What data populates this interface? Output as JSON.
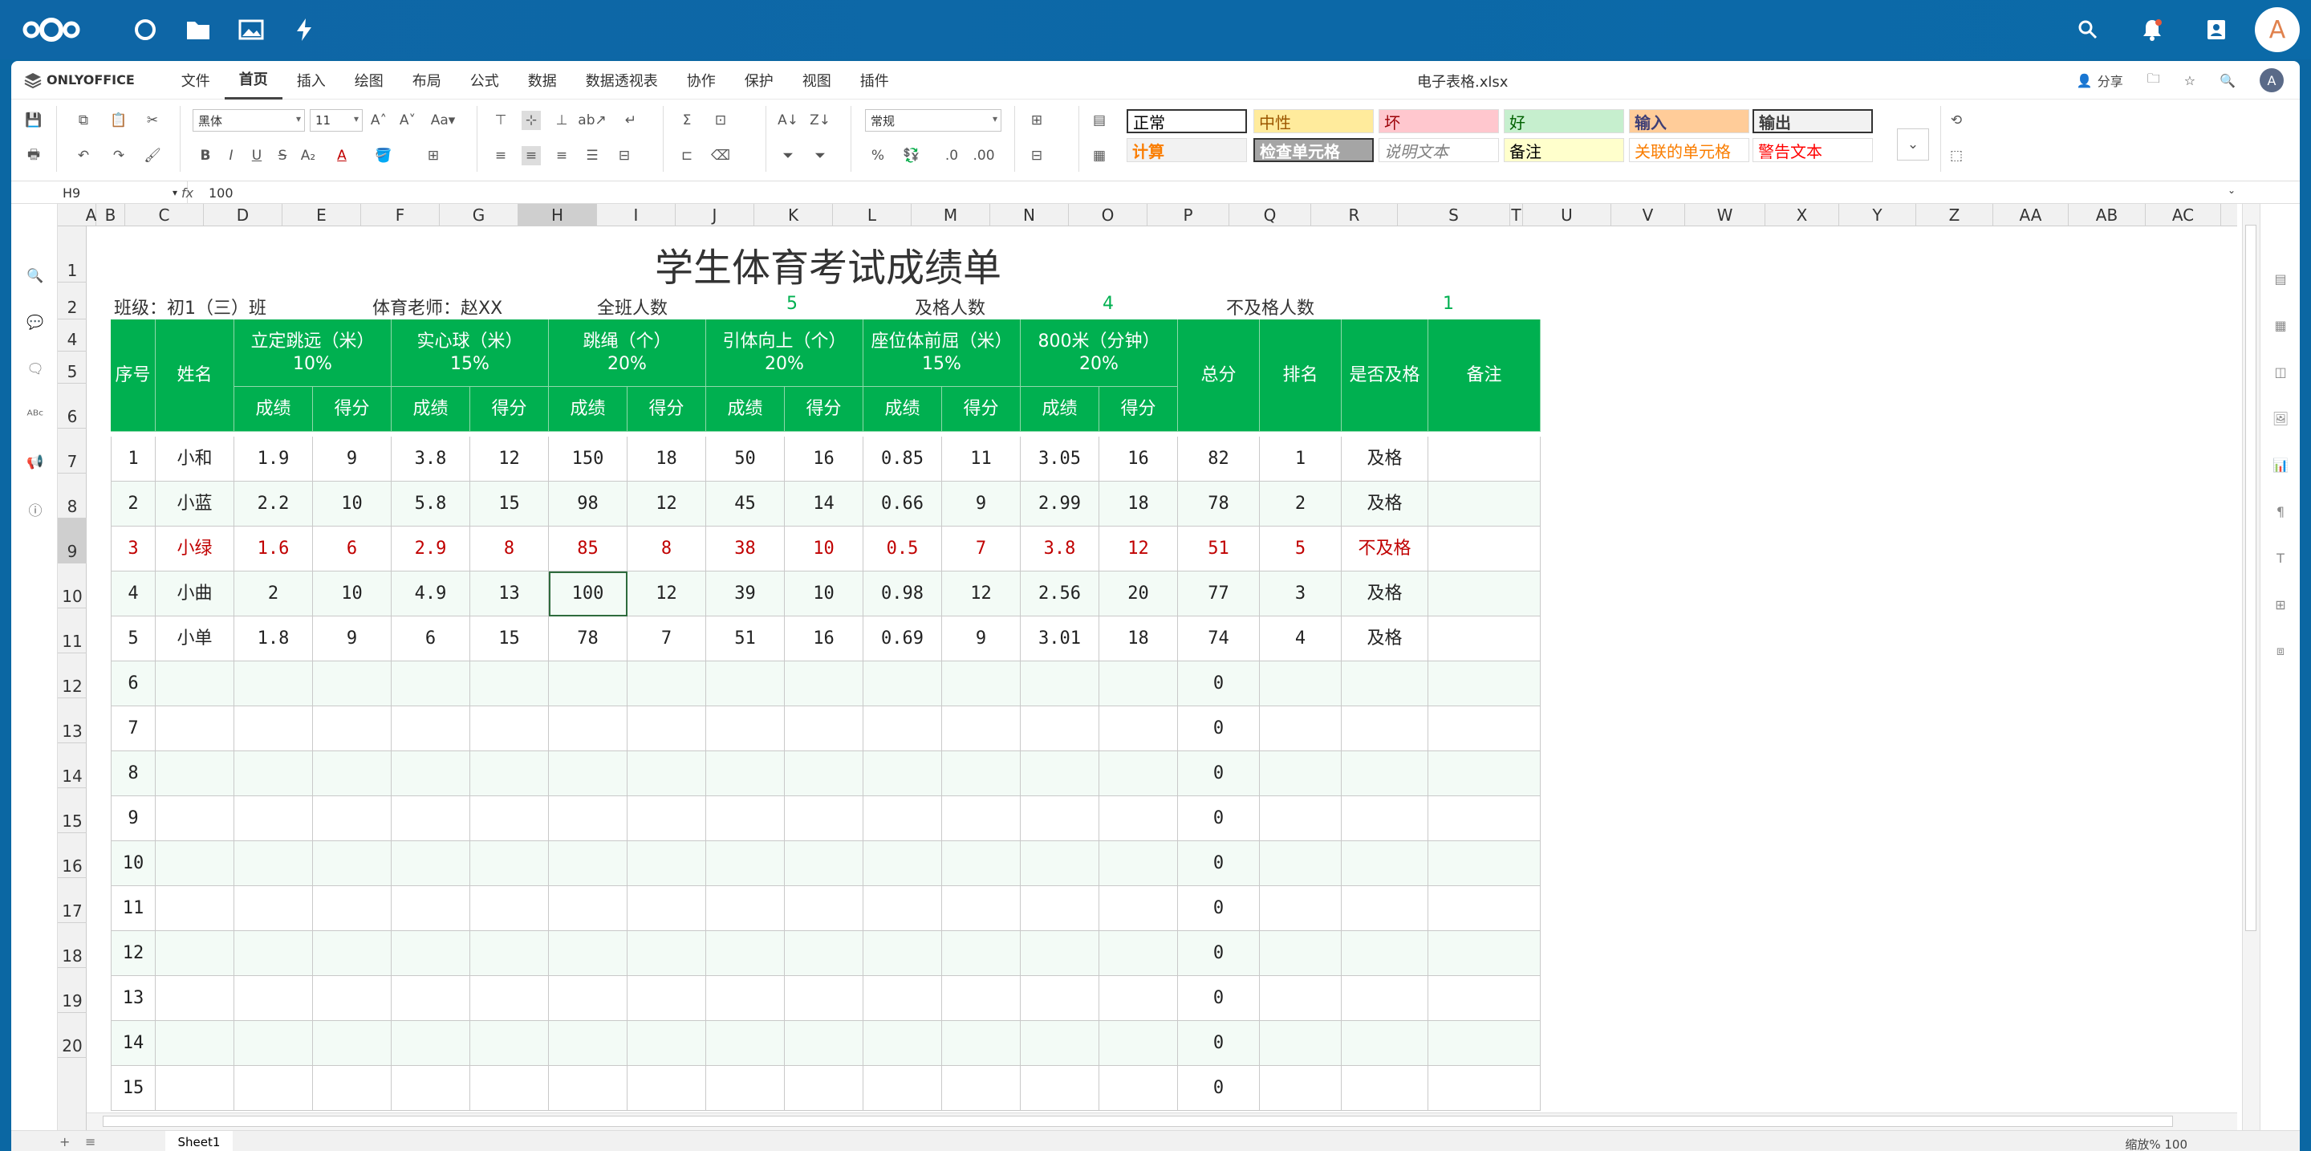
{
  "nc": {
    "apps": [
      "dashboard",
      "files",
      "photos",
      "activity"
    ],
    "avatar": "A"
  },
  "app": {
    "brand": "ONLYOFFICE",
    "menu_tabs": [
      "文件",
      "首页",
      "插入",
      "绘图",
      "布局",
      "公式",
      "数据",
      "数据透视表",
      "协作",
      "保护",
      "视图",
      "插件"
    ],
    "active_tab": "首页",
    "doc_title": "电子表格.xlsx",
    "share_label": "分享",
    "user_initial": "A"
  },
  "toolbar": {
    "font_name": "黑体",
    "font_size": "11",
    "number_format": "常规",
    "styles": [
      {
        "label": "正常",
        "bg": "#ffffff",
        "fg": "#000000"
      },
      {
        "label": "中性",
        "bg": "#ffeb9c",
        "fg": "#9c5700"
      },
      {
        "label": "坏",
        "bg": "#ffc7ce",
        "fg": "#9c0006"
      },
      {
        "label": "好",
        "bg": "#c6efce",
        "fg": "#006100"
      },
      {
        "label": "输入",
        "bg": "#ffcc99",
        "fg": "#3f3f76"
      },
      {
        "label": "输出",
        "bg": "#f2f2f2",
        "fg": "#3f3f3f"
      },
      {
        "label": "计算",
        "bg": "#f2f2f2",
        "fg": "#fa7d00"
      },
      {
        "label": "检查单元格",
        "bg": "#a5a5a5",
        "fg": "#ffffff"
      },
      {
        "label": "说明文本",
        "bg": "#ffffff",
        "fg": "#7f7f7f"
      },
      {
        "label": "备注",
        "bg": "#ffffcc",
        "fg": "#000000"
      },
      {
        "label": "关联的单元格",
        "bg": "#ffffff",
        "fg": "#fa7d00"
      },
      {
        "label": "警告文本",
        "bg": "#ffffff",
        "fg": "#ff0000"
      }
    ]
  },
  "formula_bar": {
    "cell_ref": "H9",
    "fx": "fx",
    "value": "100"
  },
  "columns": [
    "A",
    "B",
    "C",
    "D",
    "E",
    "F",
    "G",
    "H",
    "I",
    "J",
    "K",
    "L",
    "M",
    "N",
    "O",
    "P",
    "Q",
    "R",
    "S",
    "T",
    "U",
    "V",
    "W",
    "X",
    "Y",
    "Z",
    "AA",
    "AB",
    "AC"
  ],
  "rows": [
    "1",
    "2",
    "4",
    "5",
    "6",
    "7",
    "8",
    "9",
    "10",
    "11",
    "12",
    "13",
    "14",
    "15",
    "16",
    "17",
    "18",
    "19",
    "20"
  ],
  "sheet": {
    "title": "学生体育考试成绩单",
    "info": {
      "class": "班级：初1（三）班",
      "teacher": "体育老师：赵XX",
      "total_label": "全班人数",
      "total": "5",
      "pass_label": "及格人数",
      "pass": "4",
      "fail_label": "不及格人数",
      "fail": "1"
    },
    "h_seq": "序号",
    "h_name": "姓名",
    "h_total": "总分",
    "h_rank": "排名",
    "h_pass": "是否及格",
    "h_note": "备注",
    "events": [
      {
        "name": "立定跳远（米）",
        "weight": "10%"
      },
      {
        "name": "实心球（米）",
        "weight": "15%"
      },
      {
        "name": "跳绳（个）",
        "weight": "20%"
      },
      {
        "name": "引体向上（个）",
        "weight": "20%"
      },
      {
        "name": "座位体前屈（米）",
        "weight": "15%"
      },
      {
        "name": "800米（分钟）",
        "weight": "20%"
      }
    ],
    "sub_score": "成绩",
    "sub_points": "得分",
    "students": [
      [
        "1",
        "小和",
        "1.9",
        "9",
        "3.8",
        "12",
        "150",
        "18",
        "50",
        "16",
        "0.85",
        "11",
        "3.05",
        "16",
        "82",
        "1",
        "及格",
        ""
      ],
      [
        "2",
        "小蓝",
        "2.2",
        "10",
        "5.8",
        "15",
        "98",
        "12",
        "45",
        "14",
        "0.66",
        "9",
        "2.99",
        "18",
        "78",
        "2",
        "及格",
        ""
      ],
      [
        "3",
        "小绿",
        "1.6",
        "6",
        "2.9",
        "8",
        "85",
        "8",
        "38",
        "10",
        "0.5",
        "7",
        "3.8",
        "12",
        "51",
        "5",
        "不及格",
        ""
      ],
      [
        "4",
        "小曲",
        "2",
        "10",
        "4.9",
        "13",
        "100",
        "12",
        "39",
        "10",
        "0.98",
        "12",
        "2.56",
        "20",
        "77",
        "3",
        "及格",
        ""
      ],
      [
        "5",
        "小单",
        "1.8",
        "9",
        "6",
        "15",
        "78",
        "7",
        "51",
        "16",
        "0.69",
        "9",
        "3.01",
        "18",
        "74",
        "4",
        "及格",
        ""
      ],
      [
        "6",
        "",
        "",
        "",
        "",
        "",
        "",
        "",
        "",
        "",
        "",
        "",
        "",
        "",
        "0",
        "",
        "",
        ""
      ],
      [
        "7",
        "",
        "",
        "",
        "",
        "",
        "",
        "",
        "",
        "",
        "",
        "",
        "",
        "",
        "0",
        "",
        "",
        ""
      ],
      [
        "8",
        "",
        "",
        "",
        "",
        "",
        "",
        "",
        "",
        "",
        "",
        "",
        "",
        "",
        "0",
        "",
        "",
        ""
      ],
      [
        "9",
        "",
        "",
        "",
        "",
        "",
        "",
        "",
        "",
        "",
        "",
        "",
        "",
        "",
        "0",
        "",
        "",
        ""
      ],
      [
        "10",
        "",
        "",
        "",
        "",
        "",
        "",
        "",
        "",
        "",
        "",
        "",
        "",
        "",
        "0",
        "",
        "",
        ""
      ],
      [
        "11",
        "",
        "",
        "",
        "",
        "",
        "",
        "",
        "",
        "",
        "",
        "",
        "",
        "",
        "0",
        "",
        "",
        ""
      ],
      [
        "12",
        "",
        "",
        "",
        "",
        "",
        "",
        "",
        "",
        "",
        "",
        "",
        "",
        "",
        "0",
        "",
        "",
        ""
      ],
      [
        "13",
        "",
        "",
        "",
        "",
        "",
        "",
        "",
        "",
        "",
        "",
        "",
        "",
        "",
        "0",
        "",
        "",
        ""
      ],
      [
        "14",
        "",
        "",
        "",
        "",
        "",
        "",
        "",
        "",
        "",
        "",
        "",
        "",
        "",
        "0",
        "",
        "",
        ""
      ],
      [
        "15",
        "",
        "",
        "",
        "",
        "",
        "",
        "",
        "",
        "",
        "",
        "",
        "",
        "",
        "0",
        "",
        "",
        ""
      ]
    ],
    "fail_row": 2
  },
  "sheet_tab": "Sheet1",
  "zoom": "缩放% 100",
  "colors": {
    "header_green": "#00b050",
    "fail_red": "#c00000",
    "info_green": "#00b050",
    "row_alt": "#f3fbf6"
  }
}
